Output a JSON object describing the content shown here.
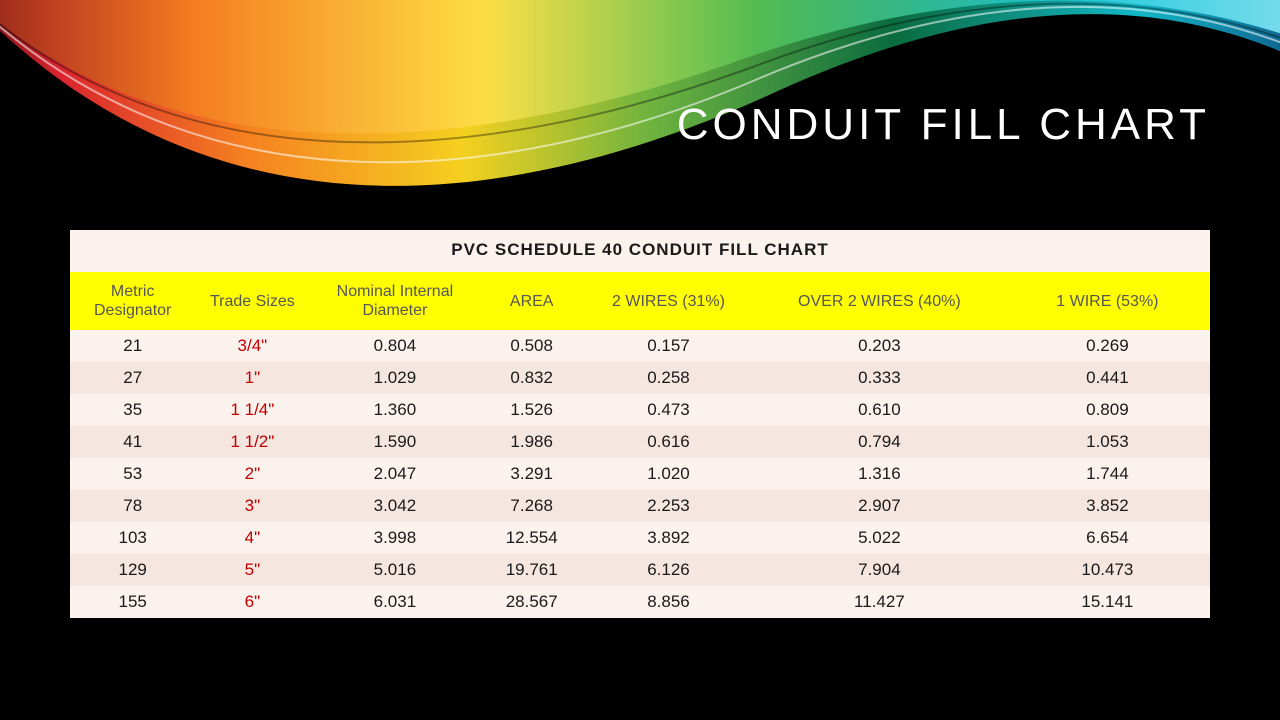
{
  "title": "CONDUIT FILL CHART",
  "table_title": "PVC SCHEDULE 40 CONDUIT FILL CHART",
  "columns": [
    "Metric Designator",
    "Trade Sizes",
    "Nominal Internal Diameter",
    "AREA",
    "2 WIRES (31%)",
    "OVER 2 WIRES (40%)",
    "1 WIRE (53%)"
  ],
  "rows": [
    {
      "metric": "21",
      "trade": "3/4\"",
      "nid": "0.804",
      "area": "0.508",
      "w2": "0.157",
      "o2": "0.203",
      "w1": "0.269"
    },
    {
      "metric": "27",
      "trade": "1\"",
      "nid": "1.029",
      "area": "0.832",
      "w2": "0.258",
      "o2": "0.333",
      "w1": "0.441"
    },
    {
      "metric": "35",
      "trade": "1 1/4\"",
      "nid": "1.360",
      "area": "1.526",
      "w2": "0.473",
      "o2": "0.610",
      "w1": "0.809"
    },
    {
      "metric": "41",
      "trade": "1 1/2\"",
      "nid": "1.590",
      "area": "1.986",
      "w2": "0.616",
      "o2": "0.794",
      "w1": "1.053"
    },
    {
      "metric": "53",
      "trade": "2\"",
      "nid": "2.047",
      "area": "3.291",
      "w2": "1.020",
      "o2": "1.316",
      "w1": "1.744"
    },
    {
      "metric": "78",
      "trade": "3\"",
      "nid": "3.042",
      "area": "7.268",
      "w2": "2.253",
      "o2": "2.907",
      "w1": "3.852"
    },
    {
      "metric": "103",
      "trade": "4\"",
      "nid": "3.998",
      "area": "12.554",
      "w2": "3.892",
      "o2": "5.022",
      "w1": "6.654"
    },
    {
      "metric": "129",
      "trade": "5\"",
      "nid": "5.016",
      "area": "19.761",
      "w2": "6.126",
      "o2": "7.904",
      "w1": "10.473"
    },
    {
      "metric": "155",
      "trade": "6\"",
      "nid": "6.031",
      "area": "28.567",
      "w2": "8.856",
      "o2": "11.427",
      "w1": "15.141"
    }
  ],
  "chart_data": {
    "type": "table",
    "title": "PVC SCHEDULE 40 CONDUIT FILL CHART",
    "columns": [
      "Metric Designator",
      "Trade Sizes",
      "Nominal Internal Diameter",
      "AREA",
      "2 WIRES (31%)",
      "OVER 2 WIRES (40%)",
      "1 WIRE (53%)"
    ],
    "rows": [
      [
        21,
        "3/4\"",
        0.804,
        0.508,
        0.157,
        0.203,
        0.269
      ],
      [
        27,
        "1\"",
        1.029,
        0.832,
        0.258,
        0.333,
        0.441
      ],
      [
        35,
        "1 1/4\"",
        1.36,
        1.526,
        0.473,
        0.61,
        0.809
      ],
      [
        41,
        "1 1/2\"",
        1.59,
        1.986,
        0.616,
        0.794,
        1.053
      ],
      [
        53,
        "2\"",
        2.047,
        3.291,
        1.02,
        1.316,
        1.744
      ],
      [
        78,
        "3\"",
        3.042,
        7.268,
        2.253,
        2.907,
        3.852
      ],
      [
        103,
        "4\"",
        3.998,
        12.554,
        3.892,
        5.022,
        6.654
      ],
      [
        129,
        "5\"",
        5.016,
        19.761,
        6.126,
        7.904,
        10.473
      ],
      [
        155,
        "6\"",
        6.031,
        28.567,
        8.856,
        11.427,
        15.141
      ]
    ]
  }
}
